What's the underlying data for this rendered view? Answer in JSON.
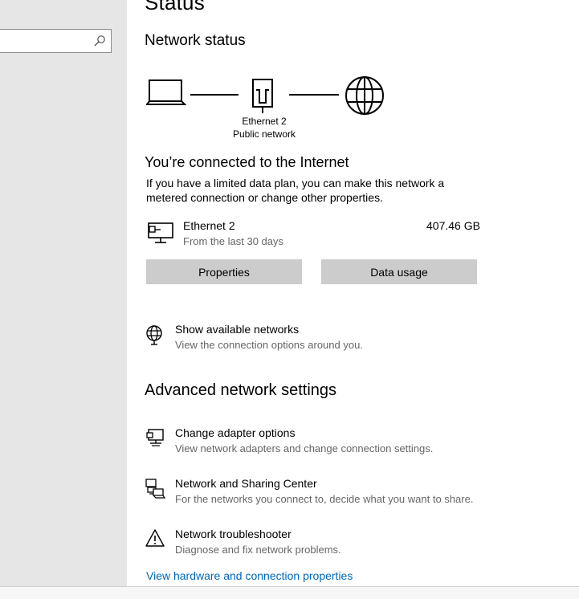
{
  "page": {
    "title": "Status"
  },
  "sidebar": {
    "search": {
      "placeholder": ""
    }
  },
  "network_status": {
    "heading": "Network status",
    "adapter_name": "Ethernet 2",
    "network_type": "Public network"
  },
  "connection": {
    "heading": "You’re connected to the Internet",
    "description_line1": "If you have a limited data plan, you can make this network a",
    "description_line2": "metered connection or change other properties.",
    "adapter": {
      "name": "Ethernet 2",
      "period": "From the last 30 days",
      "usage": "407.46 GB"
    },
    "buttons": {
      "properties": "Properties",
      "data_usage": "Data usage"
    }
  },
  "show_networks": {
    "title": "Show available networks",
    "subtitle": "View the connection options around you."
  },
  "advanced": {
    "heading": "Advanced network settings",
    "items": [
      {
        "icon": "adapter-icon",
        "title": "Change adapter options",
        "subtitle": "View network adapters and change connection settings."
      },
      {
        "icon": "sharing-center-icon",
        "title": "Network and Sharing Center",
        "subtitle": "For the networks you connect to, decide what you want to share."
      },
      {
        "icon": "warning-icon",
        "title": "Network troubleshooter",
        "subtitle": "Diagnose and fix network problems."
      }
    ],
    "hardware_link": "View hardware and connection properties"
  }
}
